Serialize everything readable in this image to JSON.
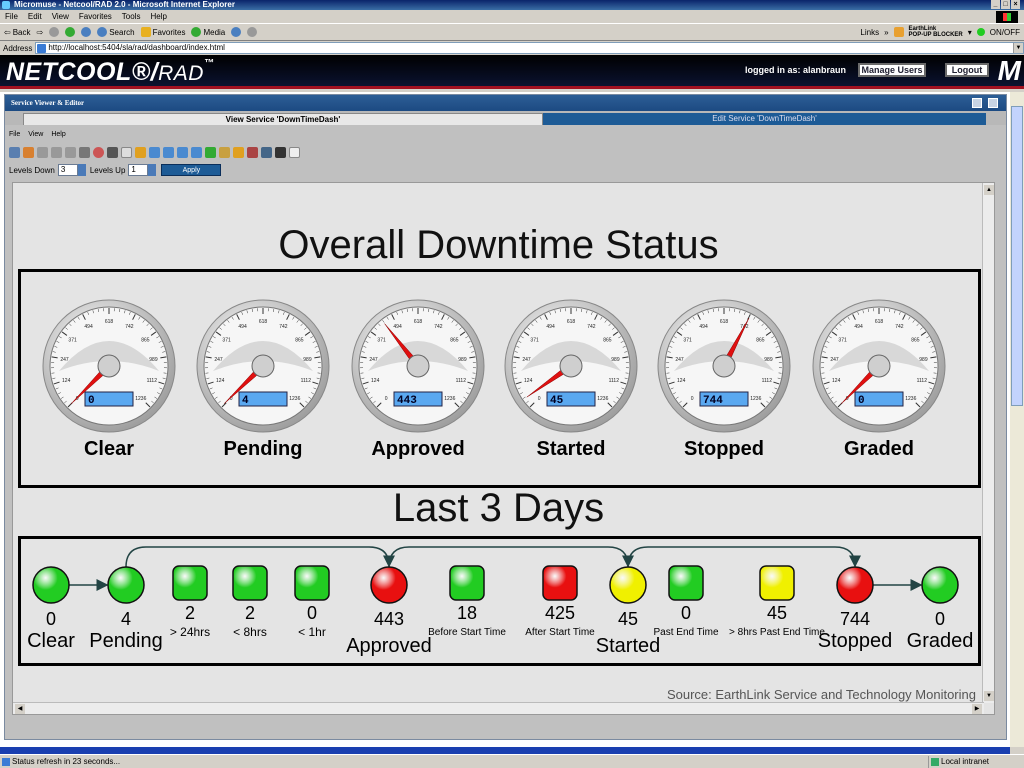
{
  "window": {
    "title": "Micromuse - Netcool/RAD 2.0 - Microsoft Internet Explorer"
  },
  "menubar": [
    "File",
    "Edit",
    "View",
    "Favorites",
    "Tools",
    "Help"
  ],
  "toolbar": {
    "back": "Back",
    "search": "Search",
    "favorites": "Favorites",
    "media": "Media",
    "links": "Links",
    "earthlink": "EarthLink",
    "popup": "POP-UP BLOCKER",
    "on": "ON/OFF"
  },
  "address": {
    "label": "Address",
    "url": "http://localhost:5404/sla/rad/dashboard/index.html"
  },
  "app": {
    "logo": "NETCOOL",
    "logo_sub": "RAD",
    "logged_in": "logged in as: alanbraun",
    "manage_users": "Manage Users",
    "logout": "Logout",
    "m_logo": "M"
  },
  "pane": {
    "title": "Service Viewer & Editor",
    "tab_view": "View Service 'DownTimeDash'",
    "tab_edit": "Edit Service 'DownTimeDash'",
    "menu": [
      "File",
      "View",
      "Help"
    ],
    "levels_down_label": "Levels Down",
    "levels_down": "3",
    "levels_up_label": "Levels Up",
    "levels_up": "1",
    "apply": "Apply"
  },
  "dashboard": {
    "title": "Overall Downtime Status",
    "subtitle": "Last 3 Days",
    "source": "Source: EarthLink Service and Technology Monitoring",
    "gauge_max": 1236,
    "gauge_ticks": [
      "0",
      "124",
      "247",
      "371",
      "494",
      "618",
      "742",
      "865",
      "989",
      "1112",
      "1236"
    ],
    "gauges": [
      {
        "label": "Clear",
        "value": 0
      },
      {
        "label": "Pending",
        "value": 4
      },
      {
        "label": "Approved",
        "value": 443
      },
      {
        "label": "Started",
        "value": 45
      },
      {
        "label": "Stopped",
        "value": 744
      },
      {
        "label": "Graded",
        "value": 0
      }
    ],
    "flow": [
      {
        "shape": "circle",
        "color": "#22cc22",
        "value": "0",
        "name": "Clear"
      },
      {
        "shape": "circle",
        "color": "#22cc22",
        "value": "4",
        "name": "Pending"
      },
      {
        "shape": "square",
        "color": "#22cc22",
        "value": "2",
        "sub": "> 24hrs"
      },
      {
        "shape": "square",
        "color": "#22cc22",
        "value": "2",
        "sub": "< 8hrs"
      },
      {
        "shape": "square",
        "color": "#22cc22",
        "value": "0",
        "sub": "< 1hr"
      },
      {
        "shape": "circle",
        "color": "#e81010",
        "value": "443",
        "name": "Approved"
      },
      {
        "shape": "square",
        "color": "#22cc22",
        "value": "18",
        "sub": "Before Start Time"
      },
      {
        "shape": "square",
        "color": "#e81010",
        "value": "425",
        "sub": "After Start Time"
      },
      {
        "shape": "circle",
        "color": "#f0f000",
        "value": "45",
        "name": "Started"
      },
      {
        "shape": "square",
        "color": "#22cc22",
        "value": "0",
        "sub": "Past End Time"
      },
      {
        "shape": "square",
        "color": "#f0f000",
        "value": "45",
        "sub": "> 8hrs Past End Time"
      },
      {
        "shape": "circle",
        "color": "#e81010",
        "value": "744",
        "name": "Stopped"
      },
      {
        "shape": "circle",
        "color": "#22cc22",
        "value": "0",
        "name": "Graded"
      }
    ]
  },
  "status": {
    "text": "Status refresh in 23 seconds...",
    "zone": "Local intranet"
  }
}
